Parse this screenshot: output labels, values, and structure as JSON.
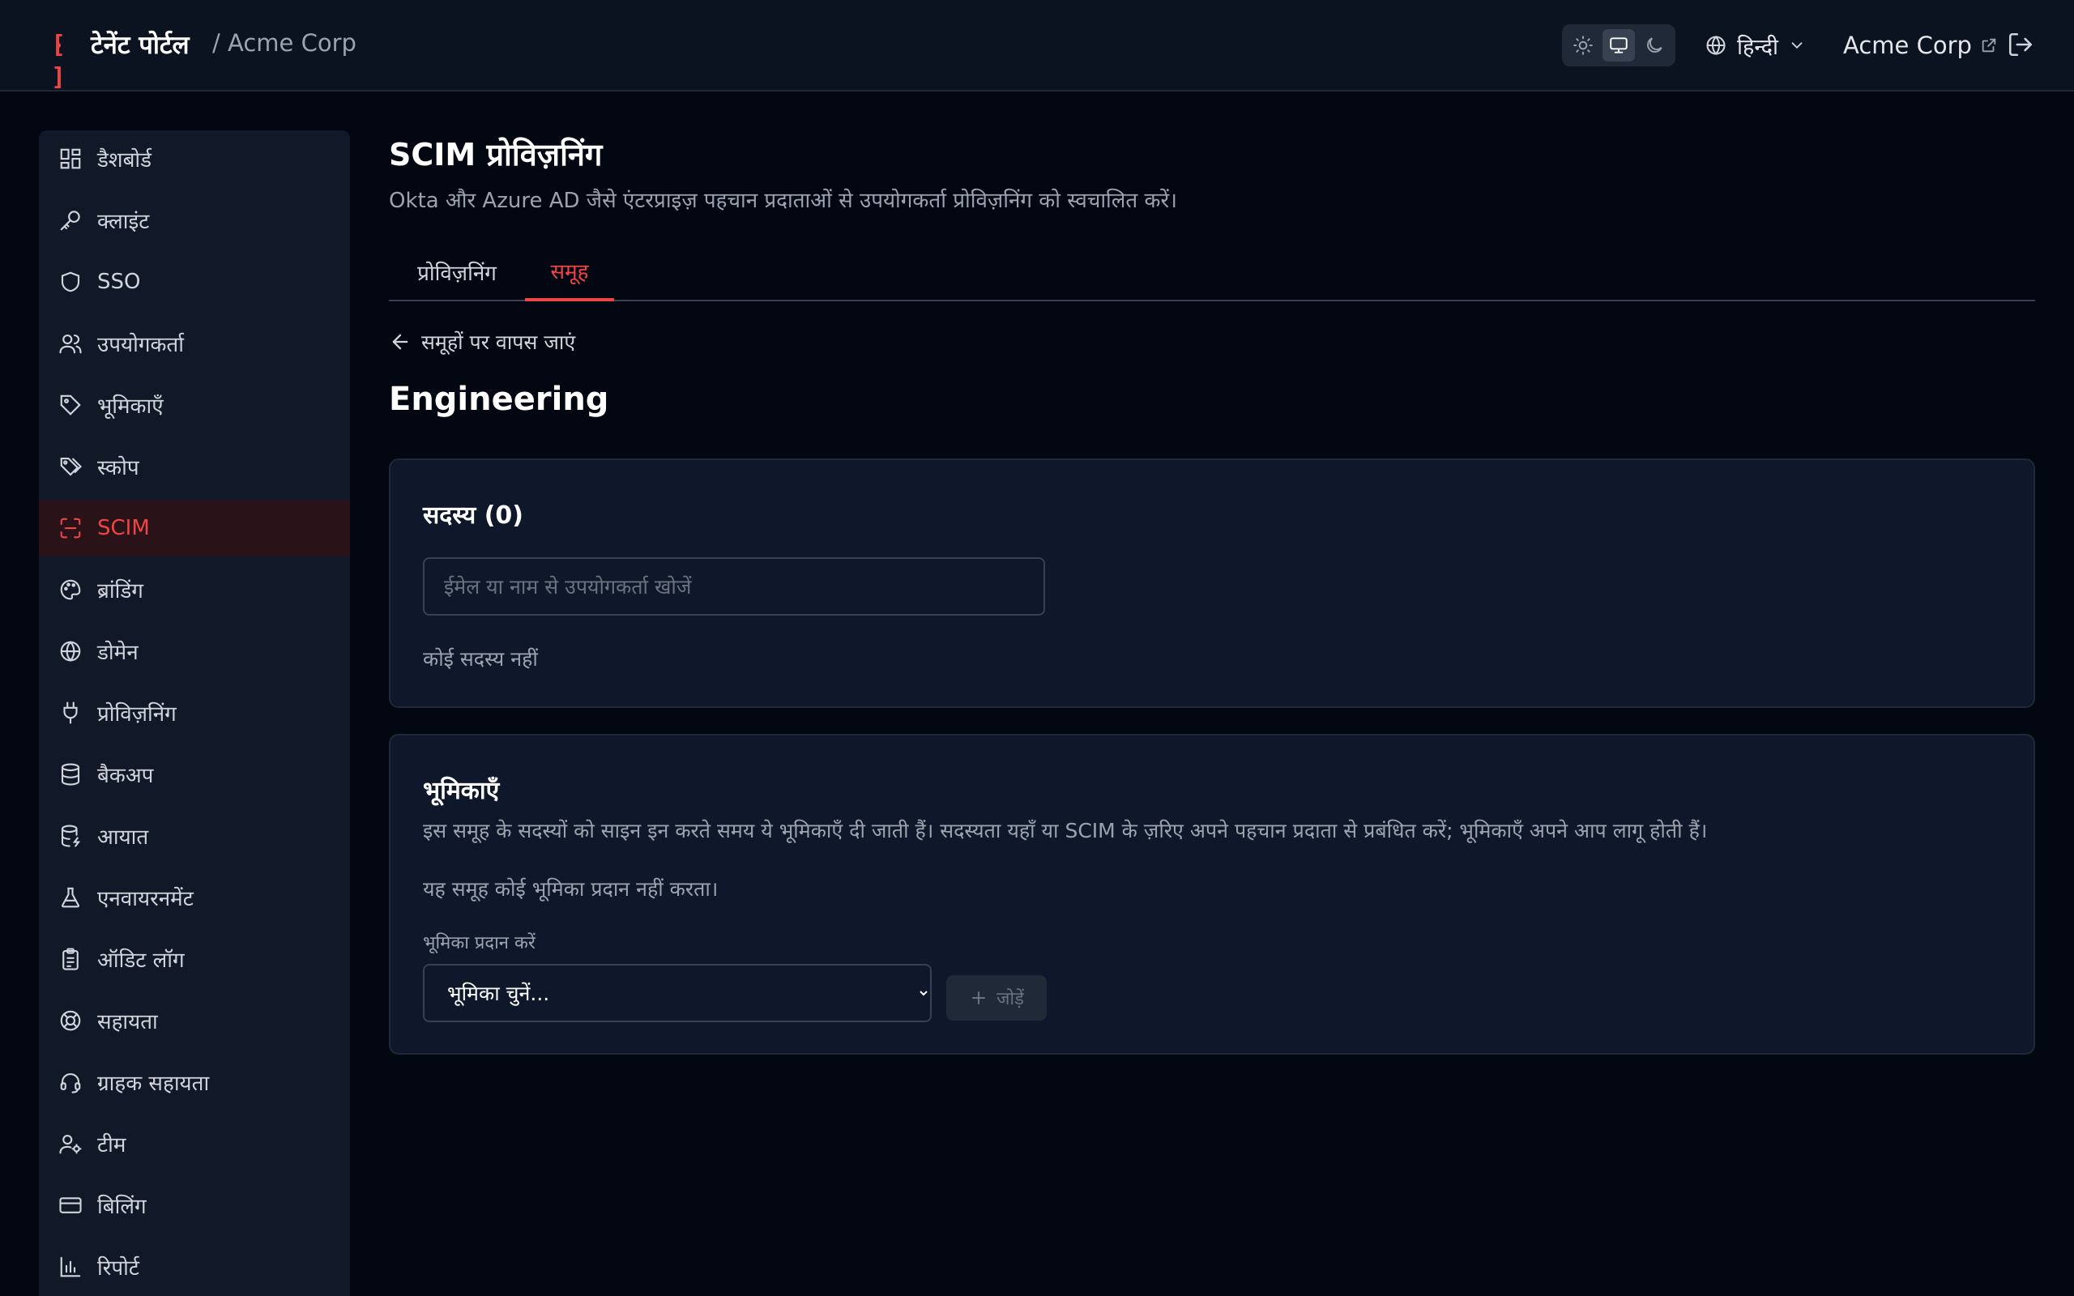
{
  "header": {
    "brand_title": "टेनेंट पोर्टल",
    "breadcrumb": "/ Acme Corp",
    "language": "हिन्दी",
    "tenant": "Acme Corp",
    "theme_options": [
      "sun-icon",
      "monitor-icon",
      "moon-icon"
    ],
    "theme_selected": "monitor-icon"
  },
  "sidebar": {
    "items": [
      {
        "label": "डैशबोर्ड",
        "icon": "dashboard-icon"
      },
      {
        "label": "क्लाइंट",
        "icon": "key-icon"
      },
      {
        "label": "SSO",
        "icon": "shield-icon"
      },
      {
        "label": "उपयोगकर्ता",
        "icon": "users-icon"
      },
      {
        "label": "भूमिकाएँ",
        "icon": "tag-icon"
      },
      {
        "label": "स्कोप",
        "icon": "tags-icon"
      },
      {
        "label": "SCIM",
        "icon": "scan-icon",
        "active": true
      },
      {
        "label": "ब्रांडिंग",
        "icon": "palette-icon"
      },
      {
        "label": "डोमेन",
        "icon": "globe-icon"
      },
      {
        "label": "प्रोविज़निंग",
        "icon": "plug-icon"
      },
      {
        "label": "बैकअप",
        "icon": "database-icon"
      },
      {
        "label": "आयात",
        "icon": "database-import-icon"
      },
      {
        "label": "एनवायरनमेंट",
        "icon": "flask-icon"
      },
      {
        "label": "ऑडिट लॉग",
        "icon": "clipboard-icon"
      },
      {
        "label": "सहायता",
        "icon": "lifebuoy-icon"
      },
      {
        "label": "ग्राहक सहायता",
        "icon": "headset-icon"
      },
      {
        "label": "टीम",
        "icon": "user-cog-icon"
      },
      {
        "label": "बिलिंग",
        "icon": "credit-card-icon"
      },
      {
        "label": "रिपोर्ट",
        "icon": "bar-chart-icon"
      }
    ]
  },
  "main": {
    "title": "SCIM प्रोविज़निंग",
    "subtitle": "Okta और Azure AD जैसे एंटरप्राइज़ पहचान प्रदाताओं से उपयोगकर्ता प्रोविज़निंग को स्वचालित करें।",
    "tabs": [
      {
        "label": "प्रोविज़निंग"
      },
      {
        "label": "समूह",
        "active": true
      }
    ],
    "back_link": "समूहों पर वापस जाएं",
    "group_name": "Engineering",
    "members": {
      "title": "सदस्य (0)",
      "search_placeholder": "ईमेल या नाम से उपयोगकर्ता खोजें",
      "empty": "कोई सदस्य नहीं"
    },
    "roles": {
      "title": "भूमिकाएँ",
      "description": "इस समूह के सदस्यों को साइन इन करते समय ये भूमिकाएँ दी जाती हैं। सदस्यता यहाँ या SCIM के ज़रिए अपने पहचान प्रदाता से प्रबंधित करें; भूमिकाएँ अपने आप लागू होती हैं।",
      "empty": "यह समूह कोई भूमिका प्रदान नहीं करता।",
      "assign_label": "भूमिका प्रदान करें",
      "select_value": "भूमिका चुनें...",
      "add_label": "जोड़ें"
    }
  },
  "colors": {
    "accent": "#ef4444",
    "background": "#030712",
    "surface": "#0f172a"
  }
}
